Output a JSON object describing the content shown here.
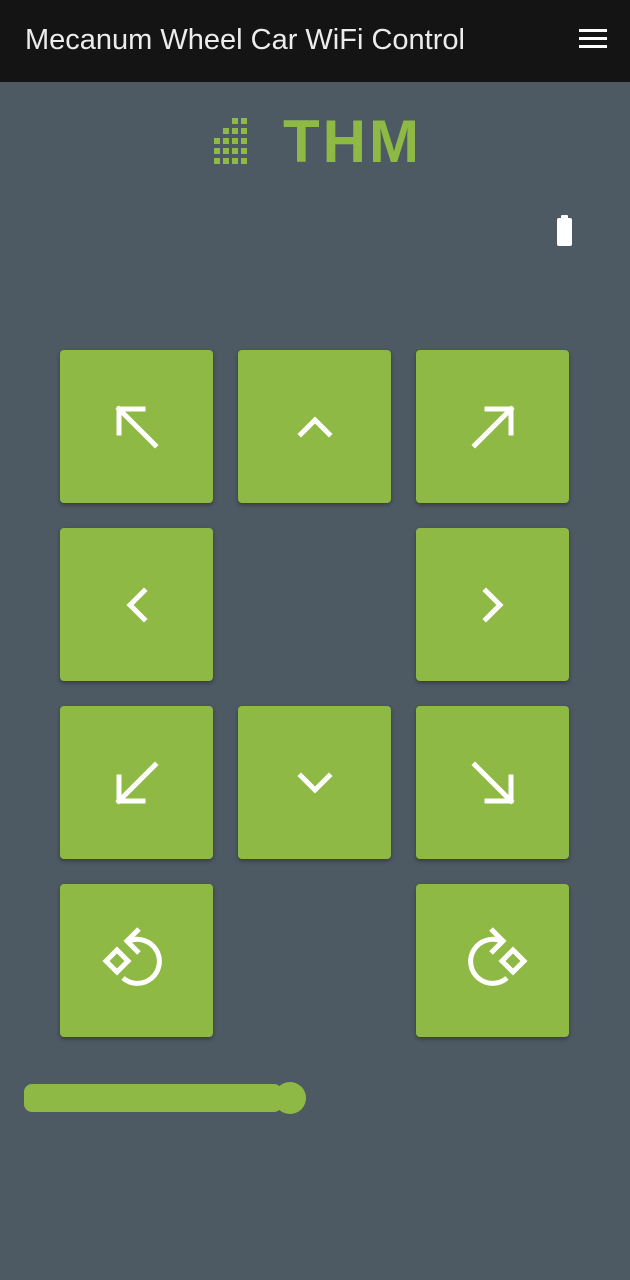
{
  "app_bar": {
    "title": "Mecanum Wheel Car WiFi Control",
    "menu_icon": "hamburger-menu-icon"
  },
  "logo": {
    "icon": "grid-dots-icon",
    "text": "THM"
  },
  "status": {
    "battery_icon": "battery-full-icon"
  },
  "controls": {
    "buttons": [
      {
        "id": "forward-left",
        "icon": "arrow-up-left-icon"
      },
      {
        "id": "forward",
        "icon": "chevron-up-icon"
      },
      {
        "id": "forward-right",
        "icon": "arrow-up-right-icon"
      },
      {
        "id": "left",
        "icon": "chevron-left-icon"
      },
      {
        "id": "right",
        "icon": "chevron-right-icon"
      },
      {
        "id": "backward-left",
        "icon": "arrow-down-left-icon"
      },
      {
        "id": "backward",
        "icon": "chevron-down-icon"
      },
      {
        "id": "backward-right",
        "icon": "arrow-down-right-icon"
      },
      {
        "id": "rotate-left",
        "icon": "rotate-left-icon"
      },
      {
        "id": "rotate-right",
        "icon": "rotate-right-icon"
      }
    ]
  },
  "speed_slider": {
    "value_fraction": 0.9
  },
  "colors": {
    "background": "#4e5a63",
    "app_bar": "#141414",
    "accent": "#8fb945",
    "icon": "#ffffff"
  }
}
